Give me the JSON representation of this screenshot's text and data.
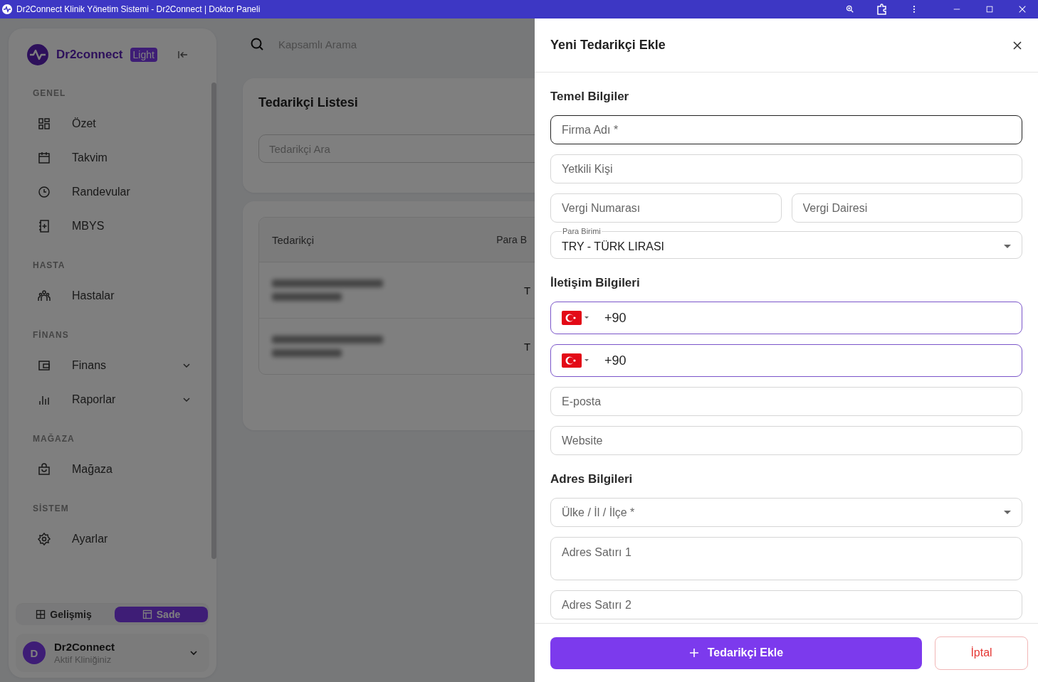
{
  "window": {
    "title": "Dr2Connect Klinik Yönetim Sistemi - Dr2Connect | Doktor Paneli"
  },
  "sidebar": {
    "brand": "Dr2connect",
    "badge": "Light",
    "sections": [
      {
        "title": "GENEL",
        "items": [
          {
            "label": "Özet",
            "kind": "link"
          },
          {
            "label": "Takvim",
            "kind": "link"
          },
          {
            "label": "Randevular",
            "kind": "link"
          },
          {
            "label": "MBYS",
            "kind": "link"
          }
        ]
      },
      {
        "title": "HASTA",
        "items": [
          {
            "label": "Hastalar",
            "kind": "link"
          }
        ]
      },
      {
        "title": "FİNANS",
        "items": [
          {
            "label": "Finans",
            "kind": "group"
          },
          {
            "label": "Raporlar",
            "kind": "group"
          }
        ]
      },
      {
        "title": "MAĞAZA",
        "items": [
          {
            "label": "Mağaza",
            "kind": "link"
          }
        ]
      },
      {
        "title": "SİSTEM",
        "items": [
          {
            "label": "Ayarlar",
            "kind": "link"
          }
        ]
      }
    ],
    "view_toggle": [
      {
        "label": "Gelişmiş",
        "selected": false
      },
      {
        "label": "Sade",
        "selected": true
      }
    ],
    "clinic": {
      "avatar": "D",
      "name": "Dr2Connect",
      "subtitle": "Aktif Kliniğiniz"
    }
  },
  "search": {
    "placeholder": "Kapsamlı Arama"
  },
  "supplier_list": {
    "title": "Tedarikçi Listesi",
    "search_placeholder": "Tedarikçi Ara",
    "table": {
      "columns": [
        "Tedarikçi",
        "Para B"
      ],
      "rows": [
        {
          "column_2": "T"
        },
        {
          "column_2": "T"
        }
      ]
    }
  },
  "drawer": {
    "title": "Yeni Tedarikçi Ekle",
    "sections": [
      {
        "title": "Temel Bilgiler",
        "rows": [
          [
            {
              "kind": "text",
              "placeholder": "Firma Adı *",
              "focused": true
            }
          ],
          [
            {
              "kind": "text",
              "placeholder": "Yetkili Kişi",
              "focused": false
            }
          ],
          [
            {
              "kind": "text",
              "placeholder": "Vergi Numarası",
              "focused": false
            },
            {
              "kind": "text",
              "placeholder": "Vergi Dairesi",
              "focused": false
            }
          ],
          [
            {
              "kind": "select",
              "label": "Para Birimi",
              "value": "TRY - TÜRK LIRASI",
              "focused": false
            }
          ]
        ]
      },
      {
        "title": "İletişim Bilgileri",
        "rows": [
          [
            {
              "kind": "phone",
              "value": "+90",
              "focused": false
            }
          ],
          [
            {
              "kind": "phone",
              "value": "+90",
              "focused": false
            }
          ],
          [
            {
              "kind": "text",
              "placeholder": "E-posta",
              "focused": false
            }
          ],
          [
            {
              "kind": "text",
              "placeholder": "Website",
              "focused": false
            }
          ]
        ]
      },
      {
        "title": "Adres Bilgileri",
        "rows": [
          [
            {
              "kind": "select",
              "placeholder": "Ülke / İl / İlçe *",
              "focused": false
            }
          ],
          [
            {
              "kind": "textarea",
              "placeholder": "Adres Satırı 1",
              "focused": false
            }
          ],
          [
            {
              "kind": "text",
              "placeholder": "Adres Satırı 2",
              "focused": false
            }
          ]
        ]
      }
    ],
    "submit": "Tedarikçi Ekle",
    "cancel": "İptal"
  }
}
